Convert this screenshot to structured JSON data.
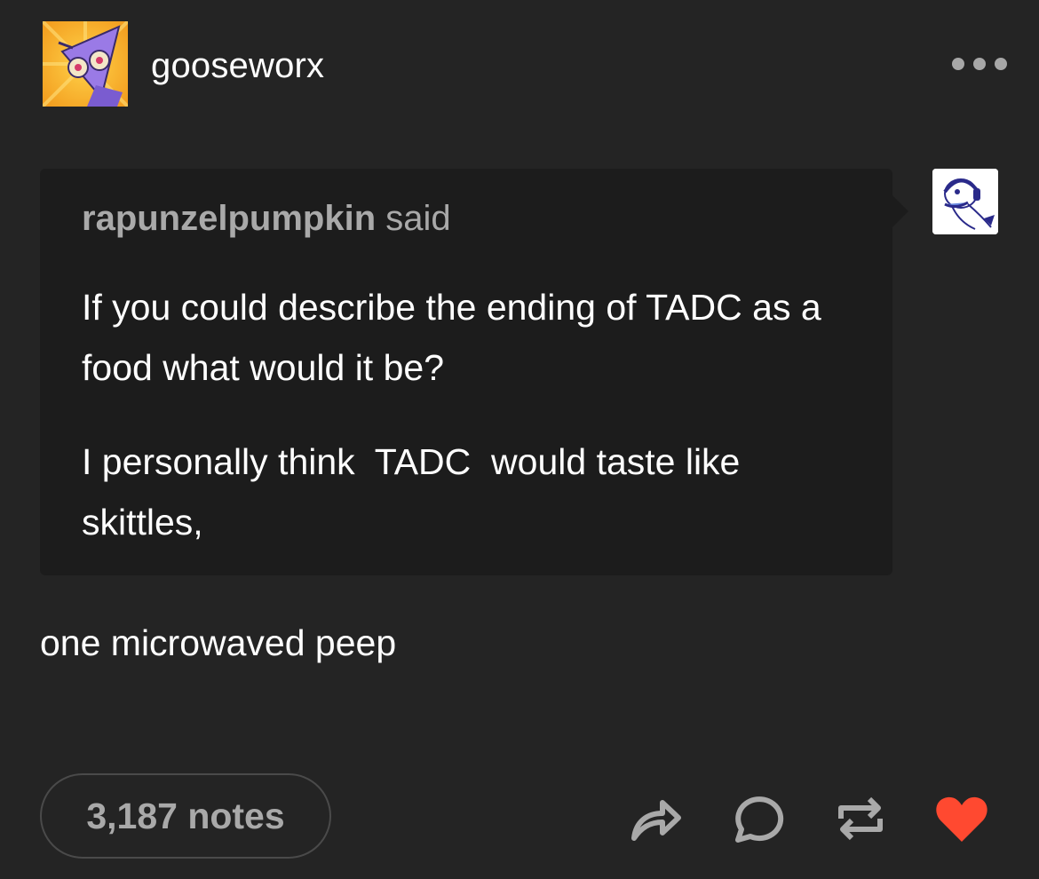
{
  "post": {
    "blog_name": "gooseworx",
    "avatar_icon": "triangle-character-avatar-icon",
    "more_icon": "ellipsis-icon"
  },
  "ask": {
    "asker": "rapunzelpumpkin",
    "said_label": "said",
    "asker_avatar_icon": "white-character-headset-avatar-icon",
    "paragraphs": [
      "If you could describe the ending of TADC as a food what would it be?",
      "I personally think  TADC  would taste like skittles,"
    ]
  },
  "answer": {
    "text": "one microwaved peep"
  },
  "footer": {
    "notes_label": "3,187 notes",
    "actions": [
      {
        "name": "share-icon"
      },
      {
        "name": "reply-icon"
      },
      {
        "name": "reblog-icon"
      },
      {
        "name": "like-icon",
        "color": "#ff4930"
      }
    ]
  },
  "colors": {
    "background": "#242424",
    "quote_background": "#1c1c1c",
    "muted_text": "#a9a9a9",
    "like_red": "#ff4930"
  }
}
